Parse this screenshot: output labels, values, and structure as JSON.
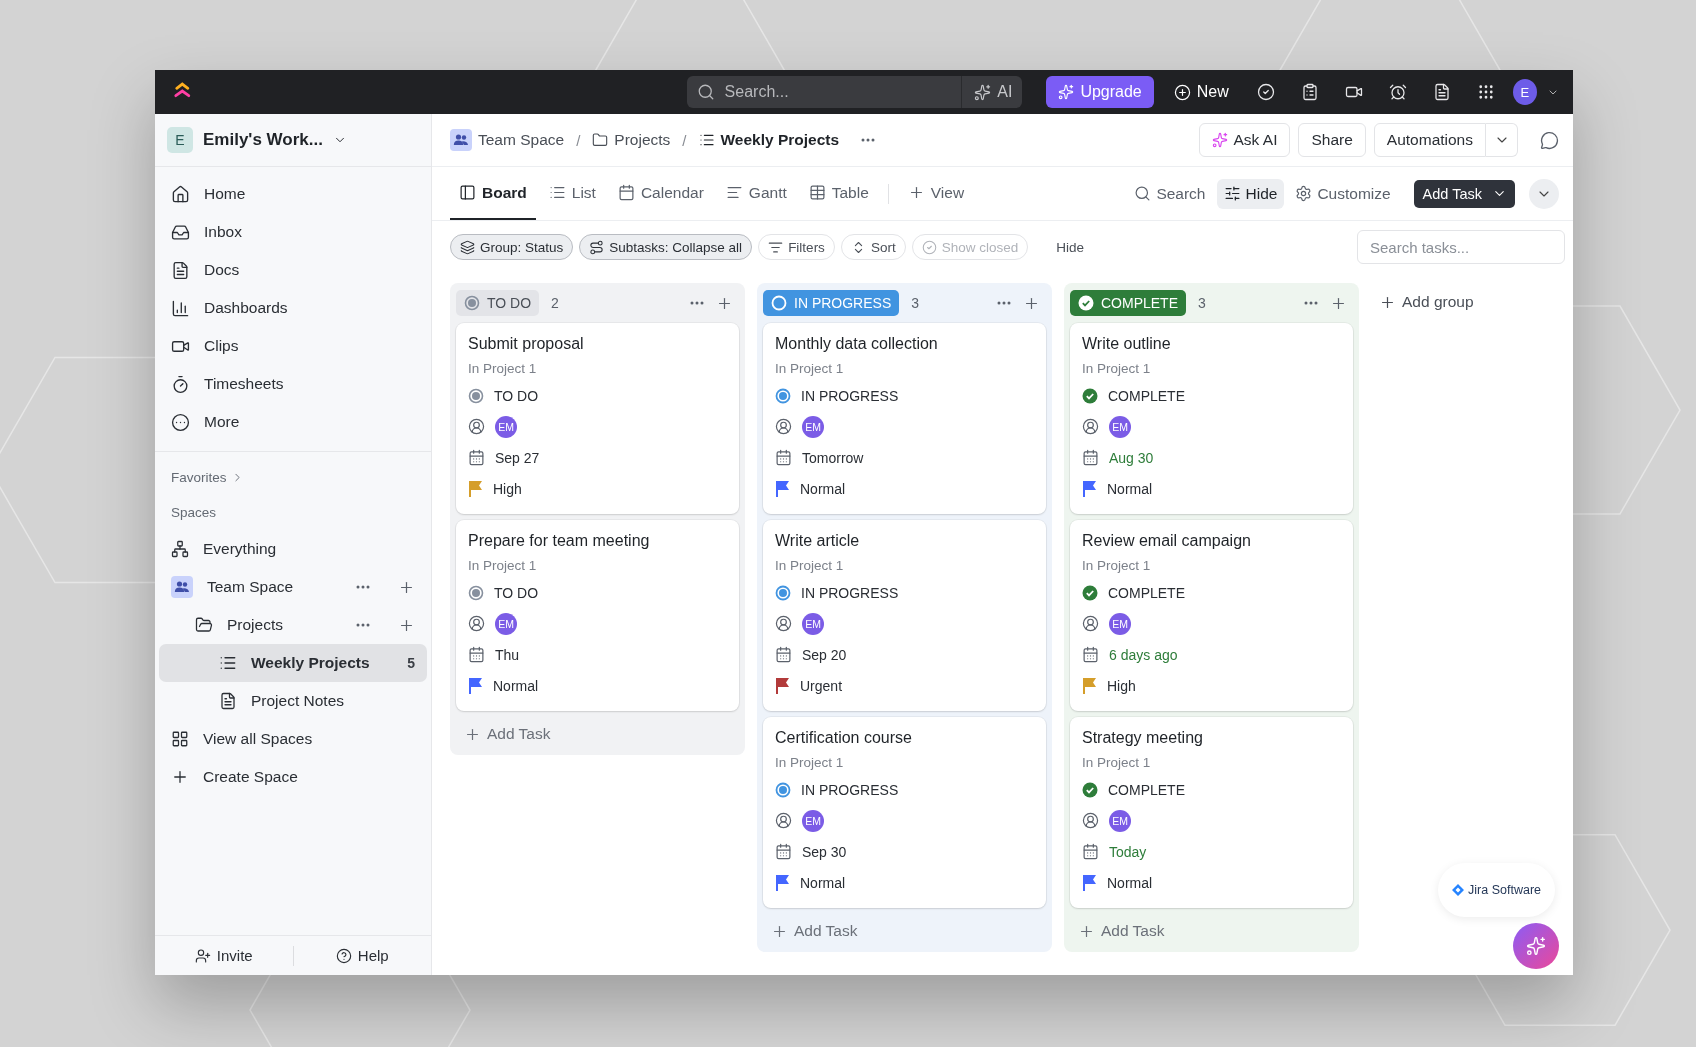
{
  "topbar": {
    "search_placeholder": "Search...",
    "ai": "AI",
    "upgrade": "Upgrade",
    "new": "New",
    "avatar": "E"
  },
  "sidebar": {
    "workspace": {
      "initial": "E",
      "name": "Emily's Work..."
    },
    "nav": [
      {
        "label": "Home"
      },
      {
        "label": "Inbox"
      },
      {
        "label": "Docs"
      },
      {
        "label": "Dashboards"
      },
      {
        "label": "Clips"
      },
      {
        "label": "Timesheets"
      },
      {
        "label": "More"
      }
    ],
    "favorites": "Favorites",
    "spaces_label": "Spaces",
    "tree": [
      {
        "kind": "everything",
        "label": "Everything",
        "selected": false
      },
      {
        "kind": "space",
        "label": "Team Space",
        "selected": false,
        "children": [
          {
            "kind": "folder",
            "label": "Projects",
            "selected": false,
            "children": [
              {
                "kind": "list",
                "label": "Weekly Projects",
                "count": "5",
                "selected": true
              },
              {
                "kind": "doc",
                "label": "Project Notes",
                "selected": false
              }
            ]
          }
        ]
      },
      {
        "kind": "allspaces",
        "label": "View all Spaces",
        "selected": false
      },
      {
        "kind": "create",
        "label": "Create Space",
        "selected": false
      }
    ],
    "footer": [
      "Invite",
      "Help"
    ]
  },
  "breadcrumb": [
    "Team Space",
    "Projects",
    "Weekly Projects"
  ],
  "breadcrumb_separator": "/",
  "header_buttons": [
    "Ask AI",
    "Share",
    "Automations"
  ],
  "view_tabs": [
    {
      "label": "Board",
      "selected": true
    },
    {
      "label": "List",
      "selected": false
    },
    {
      "label": "Calendar",
      "selected": false
    },
    {
      "label": "Gantt",
      "selected": false
    },
    {
      "label": "Table",
      "selected": false
    }
  ],
  "add_view": "View",
  "view_tools": [
    {
      "label": "Search",
      "active": false
    },
    {
      "label": "Hide",
      "active": true
    },
    {
      "label": "Customize",
      "active": false
    }
  ],
  "add_task_button": "Add Task",
  "filters": [
    {
      "label": "Group: Status",
      "kind": "chip",
      "disabled": false
    },
    {
      "label": "Subtasks: Collapse all",
      "kind": "chip",
      "disabled": false
    },
    {
      "label": "Filters",
      "kind": "outline",
      "disabled": false
    },
    {
      "label": "Sort",
      "kind": "outline",
      "disabled": false
    },
    {
      "label": "Show closed",
      "kind": "outline",
      "disabled": true
    },
    {
      "label": "Hide",
      "kind": "plain",
      "disabled": false
    }
  ],
  "task_search_placeholder": "Search tasks...",
  "columns": [
    {
      "kind": "todo",
      "status": "TO DO",
      "count": "2",
      "color": "#87909e",
      "add_task": "Add Task",
      "cards": [
        {
          "title": "Submit proposal",
          "project": "In Project 1",
          "status": "TO DO",
          "assignee": "EM",
          "due": "Sep 27",
          "due_done": false,
          "priority": "High",
          "color": "#d59e2a"
        },
        {
          "title": "Prepare for team meeting",
          "project": "In Project 1",
          "status": "TO DO",
          "assignee": "EM",
          "due": "Thu",
          "due_done": false,
          "priority": "Normal",
          "color": "#4466ff"
        }
      ]
    },
    {
      "kind": "progress",
      "status": "IN PROGRESS",
      "count": "3",
      "color": "#4194e0",
      "add_task": "Add Task",
      "cards": [
        {
          "title": "Monthly data collection",
          "project": "In Project 1",
          "status": "IN PROGRESS",
          "assignee": "EM",
          "due": "Tomorrow",
          "due_done": false,
          "priority": "Normal",
          "color": "#4466ff"
        },
        {
          "title": "Write article",
          "project": "In Project 1",
          "status": "IN PROGRESS",
          "assignee": "EM",
          "due": "Sep 20",
          "due_done": false,
          "priority": "Urgent",
          "color": "#b23a3a"
        },
        {
          "title": "Certification course",
          "project": "In Project 1",
          "status": "IN PROGRESS",
          "assignee": "EM",
          "due": "Sep 30",
          "due_done": false,
          "priority": "Normal",
          "color": "#4466ff"
        }
      ]
    },
    {
      "kind": "complete",
      "status": "COMPLETE",
      "count": "3",
      "color": "#2e7d3a",
      "add_task": "Add Task",
      "cards": [
        {
          "title": "Write outline",
          "project": "In Project 1",
          "status": "COMPLETE",
          "assignee": "EM",
          "due": "Aug 30",
          "due_done": true,
          "priority": "Normal",
          "color": "#4466ff"
        },
        {
          "title": "Review email campaign",
          "project": "In Project 1",
          "status": "COMPLETE",
          "assignee": "EM",
          "due": "6 days ago",
          "due_done": true,
          "priority": "High",
          "color": "#d59e2a"
        },
        {
          "title": "Strategy meeting",
          "project": "In Project 1",
          "status": "COMPLETE",
          "assignee": "EM",
          "due": "Today",
          "due_done": true,
          "priority": "Normal",
          "color": "#4466ff"
        }
      ]
    }
  ],
  "add_group": "Add group",
  "integration_badge": "Jira Software"
}
